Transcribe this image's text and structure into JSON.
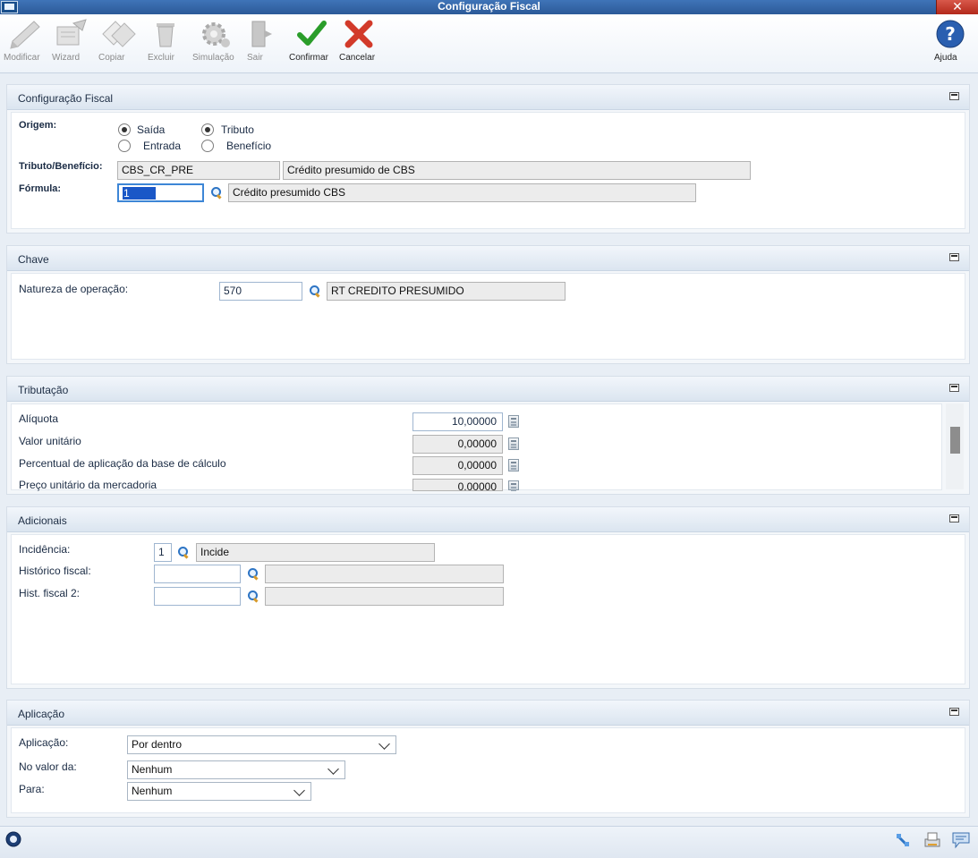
{
  "window": {
    "title": "Configuração Fiscal",
    "close_label": "✕"
  },
  "toolbar": {
    "modificar": "Modificar",
    "wizard": "Wizard",
    "copiar": "Copiar",
    "excluir": "Excluir",
    "simulacao": "Simulação",
    "sair": "Sair",
    "confirmar": "Confirmar",
    "cancelar": "Cancelar",
    "ajuda": "Ajuda"
  },
  "config_fiscal": {
    "title": "Configuração Fiscal",
    "origem_label": "Origem:",
    "origem_options": [
      "Saída",
      "Entrada"
    ],
    "origem_selected": "Saída",
    "tipo_options": [
      "Tributo",
      "Benefício"
    ],
    "tipo_selected": "Tributo",
    "tributo_label": "Tributo/Benefício:",
    "tributo_code": "CBS_CR_PRE",
    "tributo_desc": "Crédito presumido de CBS",
    "formula_label": "Fórmula:",
    "formula_value": "1",
    "formula_desc": "Crédito presumido CBS"
  },
  "chave": {
    "title": "Chave",
    "natureza_label": "Natureza de operação:",
    "natureza_value": "570",
    "natureza_desc": "RT CREDITO PRESUMIDO"
  },
  "tributacao": {
    "title": "Tributação",
    "rows": [
      {
        "label": "Alíquota",
        "value": "10,00000"
      },
      {
        "label": "Valor unitário",
        "value": "0,00000"
      },
      {
        "label": "Percentual de aplicação da base de cálculo",
        "value": "0,00000"
      },
      {
        "label": "Preço unitário da mercadoria",
        "value": "0,00000"
      }
    ]
  },
  "adicionais": {
    "title": "Adicionais",
    "incidencia_label": "Incidência:",
    "incidencia_value": "1",
    "incidencia_desc": "Incide",
    "historico_label": "Histórico fiscal:",
    "historico_value": "",
    "historico_desc": "",
    "hist2_label": "Hist. fiscal 2:",
    "hist2_value": "",
    "hist2_desc": ""
  },
  "aplicacao": {
    "title": "Aplicação",
    "aplicacao_label": "Aplicação:",
    "aplicacao_value": "Por dentro",
    "no_valor_label": "No valor da:",
    "no_valor_value": "Nenhum",
    "para_label": "Para:",
    "para_value": "Nenhum"
  },
  "colors": {
    "accent": "#2c5a98",
    "focus": "#3d86d6",
    "confirm": "#2a9d2a",
    "cancel": "#d23a2a"
  }
}
